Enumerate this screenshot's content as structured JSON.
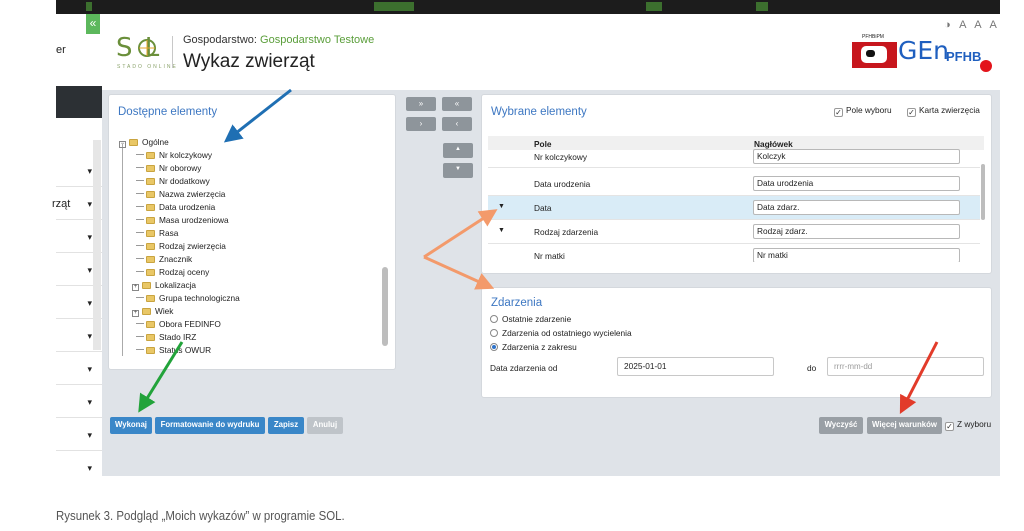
{
  "sidebar": {
    "fragment_top": "er",
    "fragment_mid": "rząt",
    "collapse_icon": "«"
  },
  "header": {
    "logo": "S  L",
    "logo_sub": "STADO ONLINE",
    "farm_label": "Gospodarstwo:",
    "farm_name": "Gospodarstwo Testowe",
    "title": "Wykaz zwierząt",
    "font_controls": "◑ A A A",
    "brand_cow_label": "PFHBiPM",
    "brand_gen": "GEn",
    "brand_pfhb": "PFHB"
  },
  "available": {
    "title": "Dostępne elementy",
    "root": "Ogólne",
    "items": [
      "Nr kolczykowy",
      "Nr oborowy",
      "Nr dodatkowy",
      "Nazwa zwierzęcia",
      "Data urodzenia",
      "Masa urodzeniowa",
      "Rasa",
      "Rodzaj zwierzęcia",
      "Znacznik",
      "Rodzaj oceny",
      "Lokalizacja",
      "Grupa technologiczna",
      "Wiek",
      "Obora FEDINFO",
      "Stado IRZ",
      "Status OWUR"
    ]
  },
  "move_buttons": {
    "add_all": "»",
    "add": "›",
    "remove_all": "«",
    "remove": "‹",
    "up": "▲",
    "down": "▼"
  },
  "chosen": {
    "title": "Wybrane elementy",
    "cb_pole": "Pole wyboru",
    "cb_karta": "Karta zwierzęcia",
    "col_pole": "Pole",
    "col_naglowek": "Nagłówek",
    "rows": [
      {
        "pole": "Nr kolczykowy",
        "naglowek": "Kolczyk"
      },
      {
        "pole": "Data urodzenia",
        "naglowek": "Data urodzenia"
      },
      {
        "pole": "Data",
        "naglowek": "Data zdarz."
      },
      {
        "pole": "Rodzaj zdarzenia",
        "naglowek": "Rodzaj zdarz."
      },
      {
        "pole": "Nr matki",
        "naglowek": "Nr matki"
      }
    ]
  },
  "events": {
    "title": "Zdarzenia",
    "options": [
      "Ostatnie zdarzenie",
      "Zdarzenia od ostatniego wycielenia",
      "Zdarzenia z zakresu"
    ],
    "selected_index": 2,
    "date_from_label": "Data zdarzenia od",
    "date_from": "2025-01-01",
    "to_label": "do",
    "date_to_placeholder": "rrrr-mm-dd"
  },
  "actions": {
    "wykonaj": "Wykonaj",
    "formatowanie": "Formatowanie do wydruku",
    "zapisz": "Zapisz",
    "anuluj": "Anuluj",
    "wyczysc": "Wyczyść",
    "wiecej": "Więcej warunków",
    "z_wyboru": "Z wyboru"
  },
  "caption": "Rysunek 3. Podgląd „Moich wykazów” w programie SOL.",
  "colors": {
    "accent_blue": "#3a87c8",
    "brand_green": "#5a9e3a",
    "arrow_blue": "#1f6fb3",
    "arrow_green": "#22a33a",
    "arrow_orange": "#f39a6b",
    "arrow_red": "#e23b2a"
  }
}
